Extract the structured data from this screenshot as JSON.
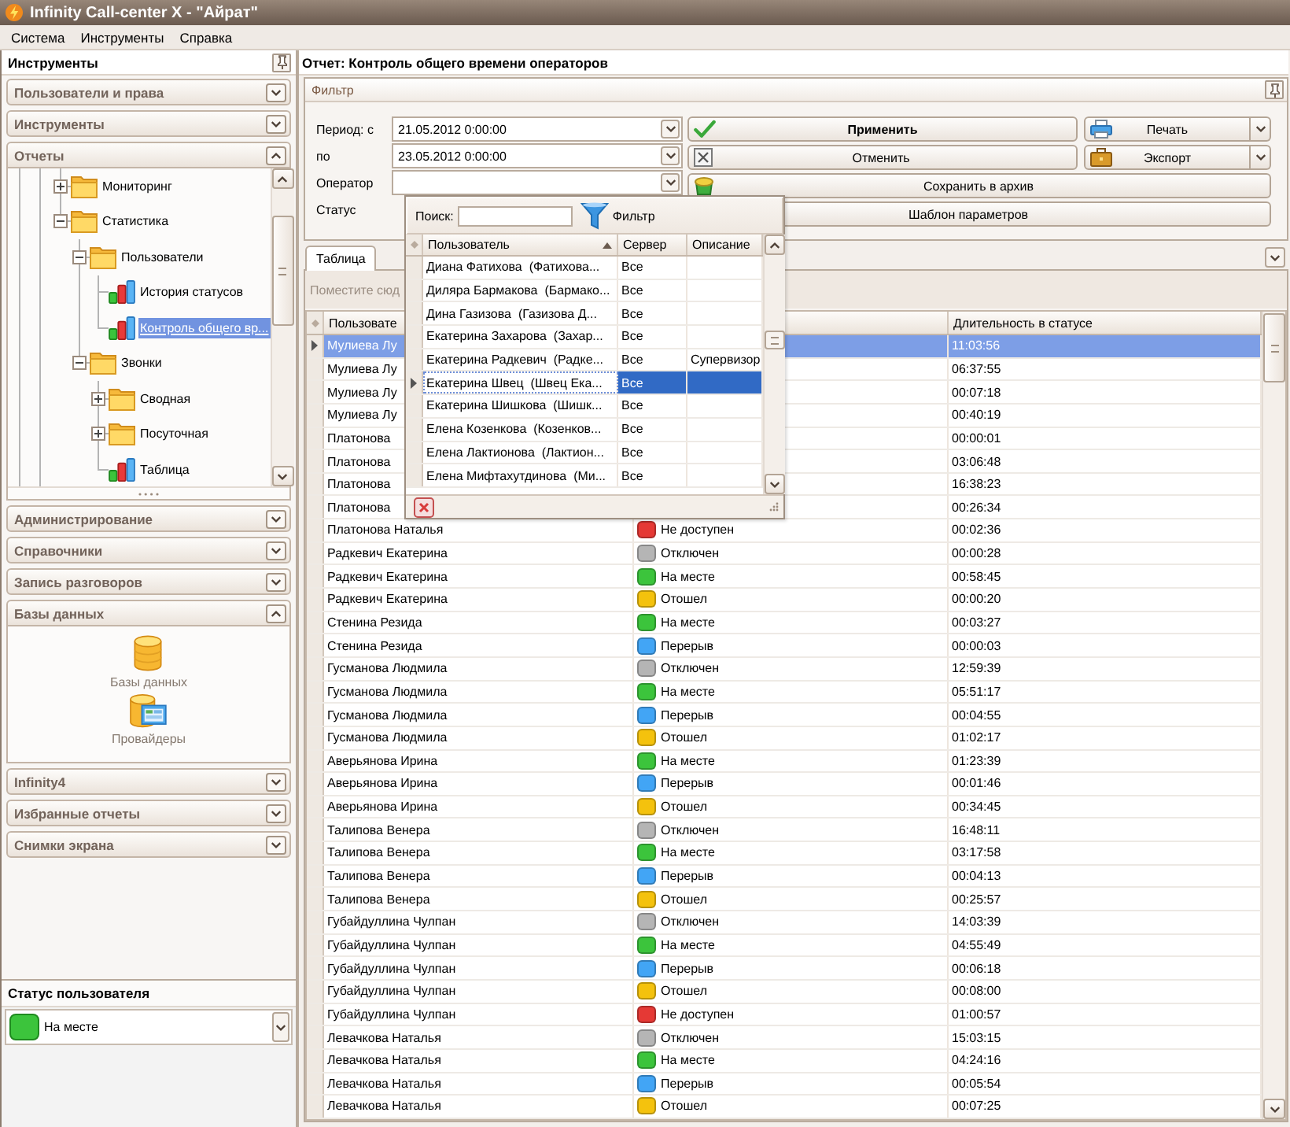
{
  "window": {
    "title": "Infinity Call-center X - \"Айрат\""
  },
  "menu": [
    "Система",
    "Инструменты",
    "Справка"
  ],
  "sidebar": {
    "title": "Инструменты",
    "sections": [
      {
        "title": "Пользователи и права",
        "expanded": false
      },
      {
        "title": "Инструменты",
        "expanded": false
      },
      {
        "title": "Отчеты",
        "kind": "tree",
        "expanded": true,
        "tree": [
          {
            "label": "Мониторинг",
            "kind": "folder",
            "expanded": false,
            "selected": false
          },
          {
            "label": "Статистика",
            "kind": "folder",
            "expanded": true,
            "selected": false,
            "children": [
              {
                "label": "Пользователи",
                "kind": "folder",
                "expanded": true,
                "selected": false,
                "children": [
                  {
                    "label": "История статусов",
                    "kind": "report",
                    "selected": false
                  },
                  {
                    "label": "Контроль общего вр...",
                    "kind": "report",
                    "selected": true
                  }
                ]
              },
              {
                "label": "Звонки",
                "kind": "folder",
                "expanded": true,
                "selected": false,
                "children": [
                  {
                    "label": "Сводная",
                    "kind": "folder",
                    "expanded": false,
                    "selected": false
                  },
                  {
                    "label": "Посуточная",
                    "kind": "folder",
                    "expanded": false,
                    "selected": false
                  },
                  {
                    "label": "Таблица",
                    "kind": "report",
                    "selected": false
                  }
                ]
              }
            ]
          }
        ]
      },
      {
        "title": "Администрирование",
        "expanded": false
      },
      {
        "title": "Справочники",
        "expanded": false
      },
      {
        "title": "Запись разговоров",
        "expanded": false
      },
      {
        "title": "Базы данных",
        "kind": "icons",
        "expanded": true,
        "items": [
          {
            "label": "Базы данных",
            "kind": "database"
          },
          {
            "label": "Провайдеры",
            "kind": "providers"
          }
        ]
      },
      {
        "title": "Infinity4",
        "expanded": false
      },
      {
        "title": "Избранные отчеты",
        "expanded": false
      },
      {
        "title": "Снимки экрана",
        "expanded": false
      }
    ]
  },
  "user_status": {
    "title": "Статус пользователя",
    "value": "На месте"
  },
  "report": {
    "title": "Отчет: Контроль общего времени операторов",
    "filter": {
      "title": "Фильтр",
      "fields": [
        {
          "label": "Период: с",
          "kind": "date",
          "value": "21.05.2012 0:00:00"
        },
        {
          "label": "по",
          "kind": "date",
          "value": "23.05.2012 0:00:00"
        },
        {
          "label": "Оператор",
          "kind": "combo"
        },
        {
          "label": "Статус",
          "kind": "label"
        }
      ],
      "buttons": [
        {
          "label": "Применить",
          "kind": "apply"
        },
        {
          "label": "Печать",
          "kind": "print"
        },
        {
          "label": "Отменить",
          "kind": "cancel"
        },
        {
          "label": "Экспорт",
          "kind": "export"
        },
        {
          "label": "Сохранить в архив",
          "kind": "archive"
        },
        {
          "label": "Шаблон параметров",
          "kind": "template"
        }
      ]
    }
  },
  "operator_popup": {
    "search_label": "Поиск:",
    "filter_label": "Фильтр",
    "columns": [
      {
        "label": "Пользователь",
        "sorted": true
      },
      {
        "label": "Сервер",
        "sorted": false
      },
      {
        "label": "Описание",
        "sorted": false
      }
    ],
    "rows": [
      {
        "user": "Диана Фатихова  (Фатихова...",
        "server": "Все",
        "selected": false
      },
      {
        "user": "Диляра Бармакова  (Бармако...",
        "server": "Все",
        "selected": false
      },
      {
        "user": "Дина Газизова  (Газизова Д...",
        "server": "Все",
        "selected": false
      },
      {
        "user": "Екатерина Захарова  (Захар...",
        "server": "Все",
        "selected": false
      },
      {
        "user": "Екатерина Радкевич  (Радке...",
        "server": "Все",
        "description": "Супервизор",
        "selected": false
      },
      {
        "user": "Екатерина Швец  (Швец Ека...",
        "server": "Все",
        "selected": true
      },
      {
        "user": "Екатерина Шишкова  (Шишк...",
        "server": "Все",
        "selected": false
      },
      {
        "user": "Елена Козенкова  (Козенков...",
        "server": "Все",
        "selected": false
      },
      {
        "user": "Елена Лактионова  (Лактион...",
        "server": "Все",
        "selected": false
      },
      {
        "user": "Елена Мифтахутдинова  (Ми...",
        "server": "Все",
        "selected": false
      }
    ]
  },
  "tabs": [
    {
      "label": "Таблица",
      "selected": true
    }
  ],
  "table": {
    "group_hint": "Поместите сюд",
    "columns": {
      "user": "Пользовате",
      "duration": "Длительность в статусе"
    },
    "rows": [
      {
        "user": "Мулиева Лу",
        "duration": "11:03:56",
        "selected": true
      },
      {
        "user": "Мулиева Лу",
        "duration": "06:37:55",
        "selected": false
      },
      {
        "user": "Мулиева Лу",
        "duration": "00:07:18",
        "selected": false
      },
      {
        "user": "Мулиева Лу",
        "duration": "00:40:19",
        "selected": false
      },
      {
        "user": "Платонова",
        "duration": "00:00:01",
        "selected": false
      },
      {
        "user": "Платонова",
        "duration": "03:06:48",
        "selected": false
      },
      {
        "user": "Платонова",
        "duration": "16:38:23",
        "selected": false
      },
      {
        "user": "Платонова",
        "duration": "00:26:34",
        "selected": false
      },
      {
        "user": "Платонова Наталья",
        "status": "Не доступен",
        "color": "#e53935",
        "duration": "00:02:36",
        "selected": false
      },
      {
        "user": "Радкевич Екатерина",
        "status": "Отключен",
        "color": "#b5b5b5",
        "duration": "00:00:28",
        "selected": false
      },
      {
        "user": "Радкевич Екатерина",
        "status": "На месте",
        "color": "#3cc43c",
        "duration": "00:58:45",
        "selected": false
      },
      {
        "user": "Радкевич Екатерина",
        "status": "Отошел",
        "color": "#f4c20d",
        "duration": "00:00:20",
        "selected": false
      },
      {
        "user": "Стенина Резида",
        "status": "На месте",
        "color": "#3cc43c",
        "duration": "00:03:27",
        "selected": false
      },
      {
        "user": "Стенина Резида",
        "status": "Перерыв",
        "color": "#42a5f5",
        "duration": "00:00:03",
        "selected": false
      },
      {
        "user": "Гусманова Людмила",
        "status": "Отключен",
        "color": "#b5b5b5",
        "duration": "12:59:39",
        "selected": false
      },
      {
        "user": "Гусманова Людмила",
        "status": "На месте",
        "color": "#3cc43c",
        "duration": "05:51:17",
        "selected": false
      },
      {
        "user": "Гусманова Людмила",
        "status": "Перерыв",
        "color": "#42a5f5",
        "duration": "00:04:55",
        "selected": false
      },
      {
        "user": "Гусманова Людмила",
        "status": "Отошел",
        "color": "#f4c20d",
        "duration": "01:02:17",
        "selected": false
      },
      {
        "user": "Аверьянова Ирина",
        "status": "На месте",
        "color": "#3cc43c",
        "duration": "01:23:39",
        "selected": false
      },
      {
        "user": "Аверьянова Ирина",
        "status": "Перерыв",
        "color": "#42a5f5",
        "duration": "00:01:46",
        "selected": false
      },
      {
        "user": "Аверьянова Ирина",
        "status": "Отошел",
        "color": "#f4c20d",
        "duration": "00:34:45",
        "selected": false
      },
      {
        "user": "Талипова Венера",
        "status": "Отключен",
        "color": "#b5b5b5",
        "duration": "16:48:11",
        "selected": false
      },
      {
        "user": "Талипова Венера",
        "status": "На месте",
        "color": "#3cc43c",
        "duration": "03:17:58",
        "selected": false
      },
      {
        "user": "Талипова Венера",
        "status": "Перерыв",
        "color": "#42a5f5",
        "duration": "00:04:13",
        "selected": false
      },
      {
        "user": "Талипова Венера",
        "status": "Отошел",
        "color": "#f4c20d",
        "duration": "00:25:57",
        "selected": false
      },
      {
        "user": "Губайдуллина Чулпан",
        "status": "Отключен",
        "color": "#b5b5b5",
        "duration": "14:03:39",
        "selected": false
      },
      {
        "user": "Губайдуллина Чулпан",
        "status": "На месте",
        "color": "#3cc43c",
        "duration": "04:55:49",
        "selected": false
      },
      {
        "user": "Губайдуллина Чулпан",
        "status": "Перерыв",
        "color": "#42a5f5",
        "duration": "00:06:18",
        "selected": false
      },
      {
        "user": "Губайдуллина Чулпан",
        "status": "Отошел",
        "color": "#f4c20d",
        "duration": "00:08:00",
        "selected": false
      },
      {
        "user": "Губайдуллина Чулпан",
        "status": "Не доступен",
        "color": "#e53935",
        "duration": "01:00:57",
        "selected": false
      },
      {
        "user": "Левачкова Наталья",
        "status": "Отключен",
        "color": "#b5b5b5",
        "duration": "15:03:15",
        "selected": false
      },
      {
        "user": "Левачкова Наталья",
        "status": "На месте",
        "color": "#3cc43c",
        "duration": "04:24:16",
        "selected": false
      },
      {
        "user": "Левачкова Наталья",
        "status": "Перерыв",
        "color": "#42a5f5",
        "duration": "00:05:54",
        "selected": false
      },
      {
        "user": "Левачкова Наталья",
        "status": "Отошел",
        "color": "#f4c20d",
        "duration": "00:07:25",
        "selected": false
      }
    ]
  }
}
